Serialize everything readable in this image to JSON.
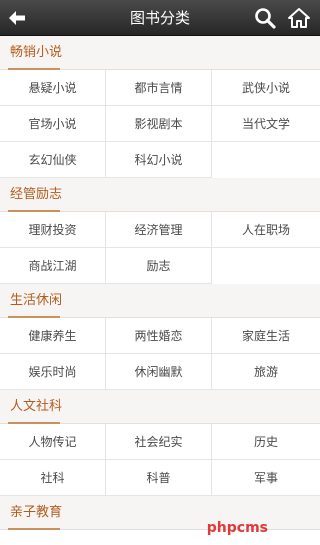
{
  "header": {
    "title": "图书分类"
  },
  "sections": [
    {
      "title": "畅销小说",
      "items": [
        "悬疑小说",
        "都市言情",
        "武侠小说",
        "官场小说",
        "影视剧本",
        "当代文学",
        "玄幻仙侠",
        "科幻小说"
      ]
    },
    {
      "title": "经管励志",
      "items": [
        "理财投资",
        "经济管理",
        "人在职场",
        "商战江湖",
        "励志"
      ]
    },
    {
      "title": "生活休闲",
      "items": [
        "健康养生",
        "两性婚恋",
        "家庭生活",
        "娱乐时尚",
        "休闲幽默",
        "旅游"
      ]
    },
    {
      "title": "人文社科",
      "items": [
        "人物传记",
        "社会纪实",
        "历史",
        "社科",
        "科普",
        "军事"
      ]
    },
    {
      "title": "亲子教育",
      "items": []
    }
  ],
  "watermark": "phpcms"
}
